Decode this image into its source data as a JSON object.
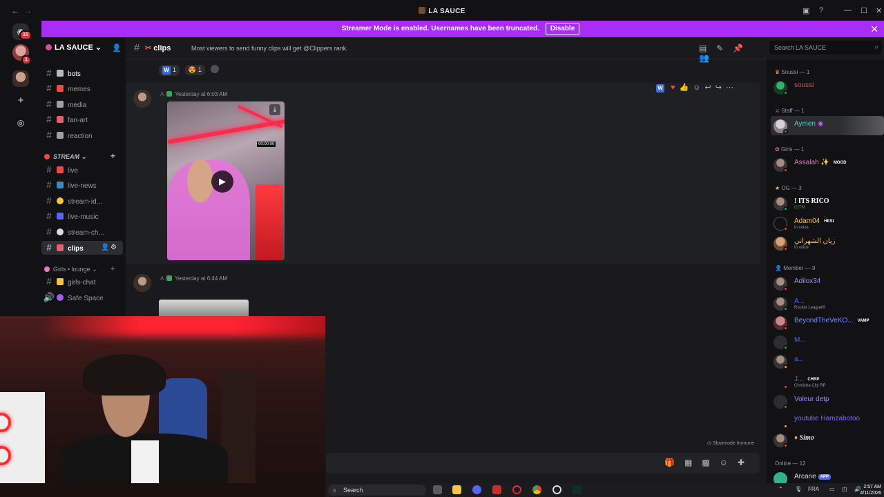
{
  "window": {
    "title": "LA SAUCE",
    "back": "←",
    "forward": "→"
  },
  "banner": {
    "text": "Streamer Mode is enabled. Usernames have been truncated.",
    "button": "Disable",
    "close": "✕"
  },
  "guilds": {
    "badge_top": "15",
    "badge_second": "1"
  },
  "server": {
    "name": "LA SAUCE"
  },
  "channels": [
    {
      "name": "bots",
      "color": "#b5bac1"
    },
    {
      "name": "memes",
      "color": "#f04747"
    },
    {
      "name": "media",
      "color": "#a0a0a0"
    },
    {
      "name": "fan-art",
      "color": "#e06070"
    },
    {
      "name": "reaction",
      "color": "#a0a0a0"
    }
  ],
  "category_stream": "STREAM",
  "stream_channels": [
    {
      "name": "live",
      "color": "#f04747"
    },
    {
      "name": "live-news",
      "color": "#3b88c3"
    },
    {
      "name": "stream-id...",
      "color": "#f5c542"
    },
    {
      "name": "live-music",
      "color": "#5865f2"
    },
    {
      "name": "stream-ch...",
      "color": "#dbdee1"
    },
    {
      "name": "clips",
      "color": "#e06070"
    }
  ],
  "category_girls": "Girls • lounge",
  "girls_channels": [
    {
      "name": "girls-chat",
      "color": "#f5c542"
    },
    {
      "name": "Safe Space",
      "color": "#a35cf0"
    }
  ],
  "channel_header": {
    "name": "clips",
    "topic": "Most viewers to send funny clips will get @Clippers rank."
  },
  "search": {
    "placeholder": "Search LA SAUCE"
  },
  "reactions": {
    "w_count": "1",
    "emoji_count": "1",
    "w_label": "W"
  },
  "messages": [
    {
      "time": "Yesterday at 6:03 AM",
      "video_timer": "00:00:00"
    },
    {
      "time": "Yesterday at 6:44 AM"
    }
  ],
  "slowmode": "Slowmode Immune",
  "members": {
    "groups": [
      {
        "label": "Soussi — 1"
      },
      {
        "label": "Staff — 1"
      },
      {
        "label": "Girls — 1"
      },
      {
        "label": "OG — 3"
      },
      {
        "label": "Member — 9"
      },
      {
        "label": "Online — 12"
      }
    ],
    "rows": [
      {
        "name": "soussi",
        "color": "#f04747",
        "sub": "",
        "tag": ""
      },
      {
        "name": "Aymen",
        "color": "#4fd1c5",
        "sub": "",
        "tag": ""
      },
      {
        "name": "Assalah ✨",
        "color": "#e879c6",
        "sub": "",
        "tag": "MOOD"
      },
      {
        "name": "! ITS RICO",
        "color": "#ffffff",
        "sub": "GJ7M",
        "tag": ""
      },
      {
        "name": "Adam04",
        "color": "#f5c542",
        "sub": "In voice",
        "tag": "HESI"
      },
      {
        "name": "زيان الشهراني",
        "color": "#f5c542",
        "sub": "In voice",
        "tag": ""
      },
      {
        "name": "Adilox34",
        "color": "#9b8cff",
        "sub": "",
        "tag": ""
      },
      {
        "name": "A...",
        "color": "#9b8cff",
        "sub": "Rocket League®",
        "tag": ""
      },
      {
        "name": "BeyondTheVeKO...",
        "color": "#9b8cff",
        "sub": "",
        "tag": "VAMP"
      },
      {
        "name": "M...",
        "color": "#9b8cff",
        "sub": "",
        "tag": ""
      },
      {
        "name": "a...",
        "color": "#9b8cff",
        "sub": "",
        "tag": ""
      },
      {
        "name": "J...",
        "color": "#9b8cff",
        "sub": "Chmicha City RP",
        "tag": "CHRP"
      },
      {
        "name": "Voleur detp",
        "color": "#9b8cff",
        "sub": "",
        "tag": ""
      },
      {
        "name": "youtube Hamzabotoo",
        "color": "#9b8cff",
        "sub": "",
        "tag": ""
      },
      {
        "name": "Simo",
        "color": "#dbdee1",
        "sub": "",
        "tag": ""
      },
      {
        "name": "Arcane",
        "color": "#dbdee1",
        "sub": "",
        "tag": "APP"
      }
    ]
  },
  "taskbar": {
    "search": "Search",
    "lang": "FRA",
    "time": "2:57 AM",
    "date": "4/11/2026"
  }
}
